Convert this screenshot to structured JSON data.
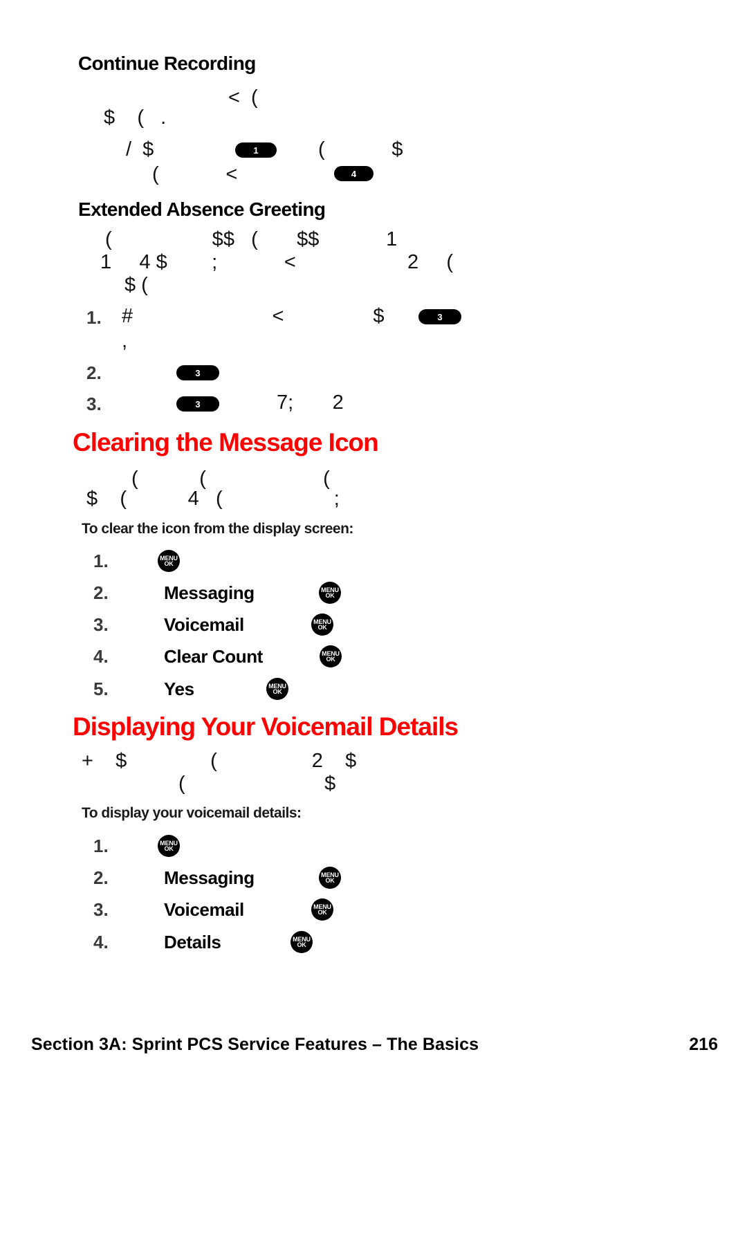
{
  "document": {
    "page_number": "216",
    "footer_title": "Section 3A: Sprint PCS Service Features – The Basics",
    "accent_color": "#ff0000"
  },
  "sections": {
    "continue_recording": {
      "heading": "Continue Recording",
      "body_lines": [
        "<  (",
        "$    (   .",
        "/  $",
        "(            <"
      ]
    },
    "extended_absence": {
      "heading": "Extended Absence Greeting",
      "body_lines": [
        "(                  $$   (       $$            1",
        "1     4 $        ;            <                    2     (",
        "$ ("
      ],
      "steps": [
        {
          "num": "1.",
          "text": "#                         <                $",
          "sub": ","
        },
        {
          "num": "2.",
          "text": ""
        },
        {
          "num": "3.",
          "text": "7;       2"
        }
      ]
    },
    "clearing_icon": {
      "heading": "Clearing the Message Icon",
      "body_lines": [
        "(           (                     (",
        "$    (           4   (                    ;"
      ],
      "lead": "To clear the icon from the display screen:",
      "steps": [
        {
          "num": "1.",
          "label": ""
        },
        {
          "num": "2.",
          "label": "Messaging"
        },
        {
          "num": "3.",
          "label": "Voicemail"
        },
        {
          "num": "4.",
          "label": "Clear Count"
        },
        {
          "num": "5.",
          "label": "Yes"
        }
      ]
    },
    "displaying_details": {
      "heading": "Displaying Your Voicemail Details",
      "body_lines": [
        "+    $               (                 2    $",
        "(                         $"
      ],
      "lead": "To display your voicemail details:",
      "steps": [
        {
          "num": "1.",
          "label": ""
        },
        {
          "num": "2.",
          "label": "Messaging"
        },
        {
          "num": "3.",
          "label": "Voicemail"
        },
        {
          "num": "4.",
          "label": "Details"
        }
      ]
    }
  },
  "key_badges": {
    "one": "1",
    "four": "4",
    "three": "3"
  },
  "menu_button": {
    "line1": "MENU",
    "line2": "OK"
  }
}
